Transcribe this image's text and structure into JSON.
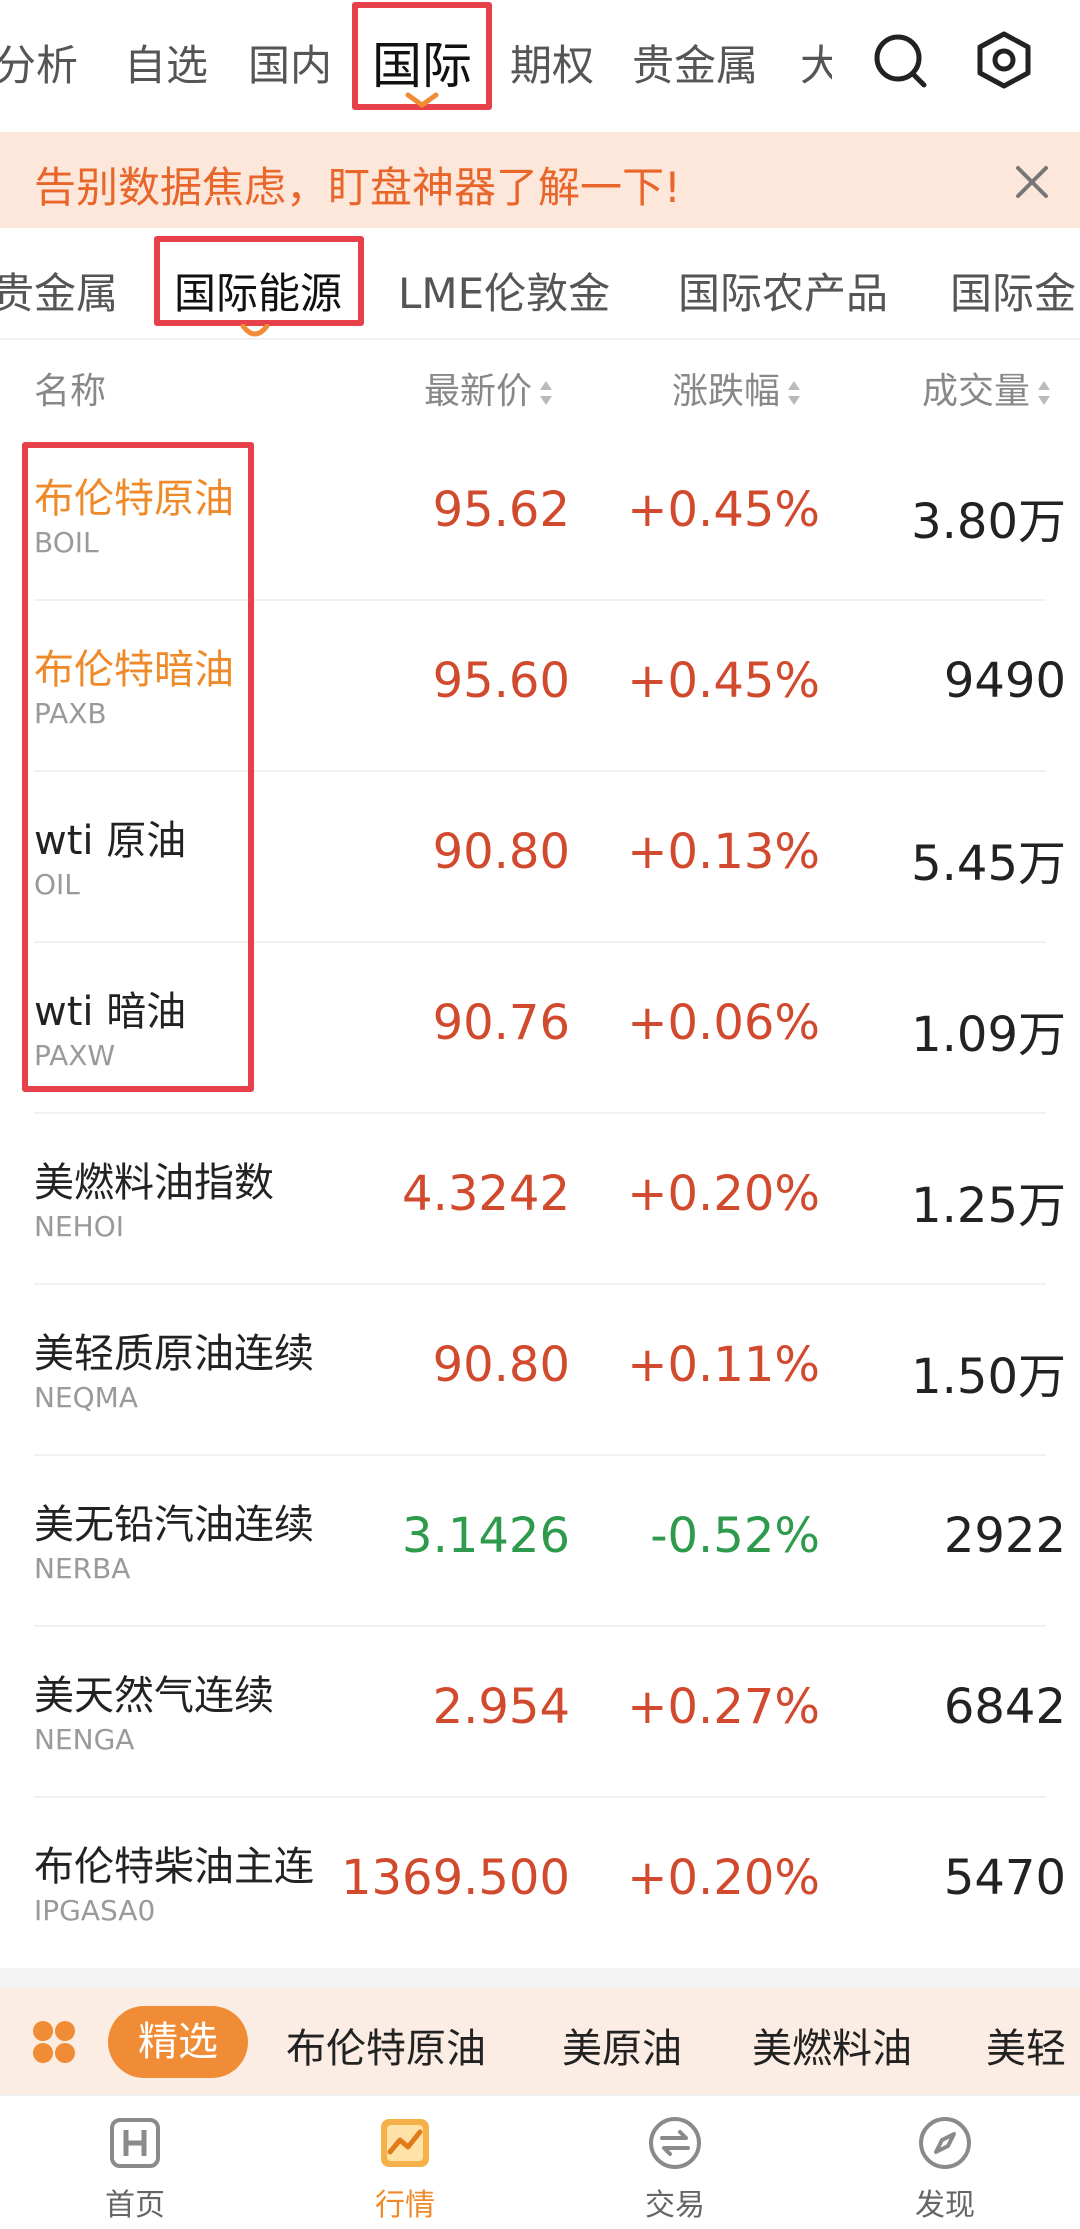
{
  "top_tabs": [
    {
      "label": "分析"
    },
    {
      "label": "自选"
    },
    {
      "label": "国内"
    },
    {
      "label": "国际"
    },
    {
      "label": "期权"
    },
    {
      "label": "贵金属"
    },
    {
      "label": "大"
    }
  ],
  "banner": {
    "text": "告别数据焦虑，盯盘神器了解一下!"
  },
  "sub_tabs": [
    {
      "label": "贵金属"
    },
    {
      "label": "国际能源"
    },
    {
      "label": "LME伦敦金"
    },
    {
      "label": "国际农产品"
    },
    {
      "label": "国际金"
    }
  ],
  "table": {
    "headers": {
      "name": "名称",
      "price": "最新价",
      "change": "涨跌幅",
      "volume": "成交量"
    },
    "rows": [
      {
        "name": "布伦特原油",
        "code": "BOIL",
        "price": "95.62",
        "change": "+0.45%",
        "volume": "3.80万",
        "dir": "up",
        "highlight": true
      },
      {
        "name": "布伦特暗油",
        "code": "PAXB",
        "price": "95.60",
        "change": "+0.45%",
        "volume": "9490",
        "dir": "up",
        "highlight": true
      },
      {
        "name": "wti 原油",
        "code": "OIL",
        "price": "90.80",
        "change": "+0.13%",
        "volume": "5.45万",
        "dir": "up",
        "highlight": false
      },
      {
        "name": "wti 暗油",
        "code": "PAXW",
        "price": "90.76",
        "change": "+0.06%",
        "volume": "1.09万",
        "dir": "up",
        "highlight": false
      },
      {
        "name": "美燃料油指数",
        "code": "NEHOI",
        "price": "4.3242",
        "change": "+0.20%",
        "volume": "1.25万",
        "dir": "up",
        "highlight": false
      },
      {
        "name": "美轻质原油连续",
        "code": "NEQMA",
        "price": "90.80",
        "change": "+0.11%",
        "volume": "1.50万",
        "dir": "up",
        "highlight": false
      },
      {
        "name": "美无铅汽油连续",
        "code": "NERBA",
        "price": "3.1426",
        "change": "-0.52%",
        "volume": "2922",
        "dir": "down",
        "highlight": false
      },
      {
        "name": "美天然气连续",
        "code": "NENGA",
        "price": "2.954",
        "change": "+0.27%",
        "volume": "6842",
        "dir": "up",
        "highlight": false
      },
      {
        "name": "布伦特柴油主连",
        "code": "IPGASA0",
        "price": "1369.500",
        "change": "+0.20%",
        "volume": "5470",
        "dir": "up",
        "highlight": false
      }
    ]
  },
  "quickbar": {
    "pill": "精选",
    "items": [
      "布伦特原油",
      "美原油",
      "美燃料油",
      "美轻"
    ]
  },
  "nav": [
    {
      "label": "首页",
      "icon": "home-h-icon"
    },
    {
      "label": "行情",
      "icon": "market-chart-icon"
    },
    {
      "label": "交易",
      "icon": "trade-exchange-icon"
    },
    {
      "label": "发现",
      "icon": "compass-icon"
    }
  ],
  "colors": {
    "up": "#d14a2e",
    "down": "#2e9a4c",
    "accent": "#ef8a2a",
    "annotation": "#e8404a"
  }
}
